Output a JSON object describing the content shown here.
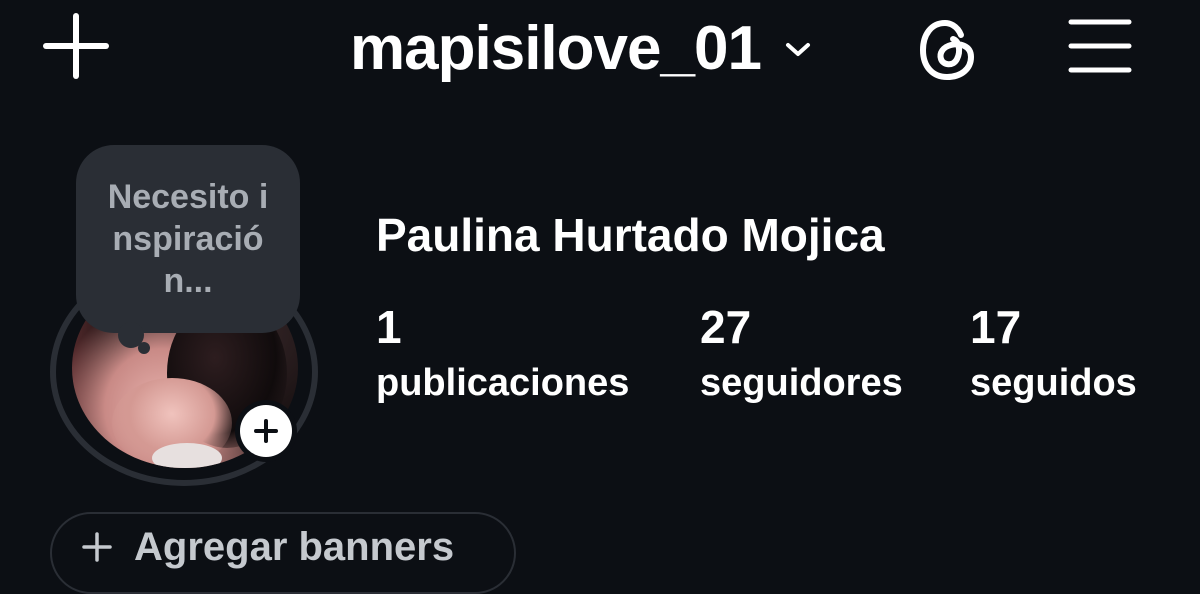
{
  "header": {
    "username": "mapisilove_01",
    "icons": {
      "create": "plus-icon",
      "account_switch": "chevron-down-icon",
      "threads": "threads-icon",
      "menu": "hamburger-menu-icon"
    }
  },
  "note": {
    "text": "Necesito inspiración..."
  },
  "profile": {
    "full_name": "Paulina Hurtado Mojica",
    "avatar_icon": "avatar-photo",
    "add_story_icon": "plus-icon"
  },
  "stats": {
    "posts": {
      "value": "1",
      "label": "publicaciones"
    },
    "followers": {
      "value": "27",
      "label": "seguidores"
    },
    "following": {
      "value": "17",
      "label": "seguidos"
    }
  },
  "banner": {
    "label": "Agregar banners",
    "icon": "plus-icon"
  },
  "colors": {
    "background": "#0c0f14",
    "surface": "#2a2e35",
    "text_primary": "#ffffff",
    "text_muted": "#a8adb4"
  }
}
